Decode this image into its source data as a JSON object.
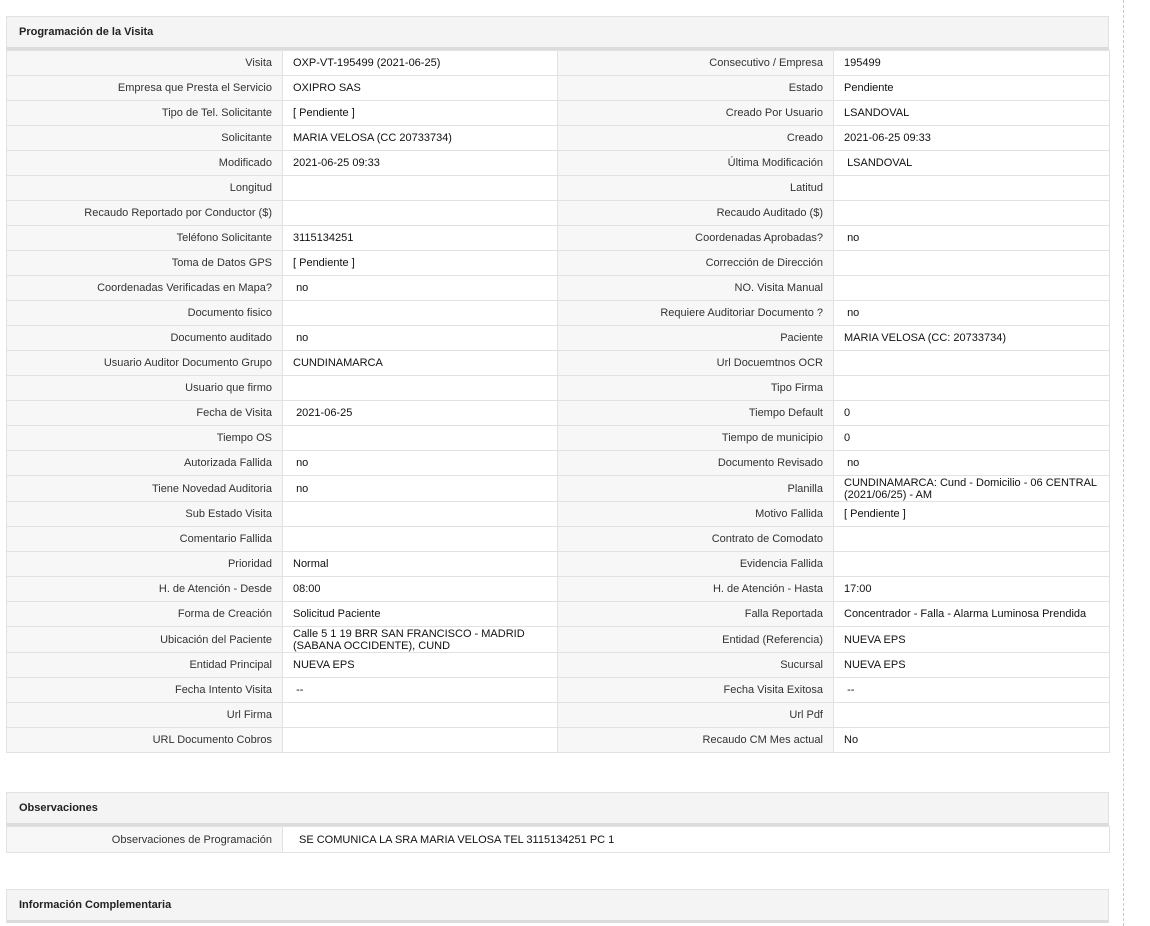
{
  "sections": {
    "programacion": "Programación de la Visita",
    "observaciones": "Observaciones",
    "informacion": "Información Complementaria"
  },
  "rows": [
    {
      "l1": "Visita",
      "v1": "OXP-VT-195499 (2021-06-25)",
      "l2": "Consecutivo / Empresa",
      "v2": "195499"
    },
    {
      "l1": "Empresa que Presta el Servicio",
      "v1": "OXIPRO SAS",
      "l2": "Estado",
      "v2": "Pendiente"
    },
    {
      "l1": "Tipo de Tel. Solicitante",
      "v1": "[ Pendiente ]",
      "l2": "Creado Por Usuario",
      "v2": "LSANDOVAL"
    },
    {
      "l1": "Solicitante",
      "v1": "MARIA VELOSA (CC 20733734)",
      "l2": "Creado",
      "v2": "2021-06-25 09:33"
    },
    {
      "l1": "Modificado",
      "v1": "2021-06-25 09:33",
      "l2": "Última Modificación",
      "v2": " LSANDOVAL"
    },
    {
      "l1": "Longitud",
      "v1": "",
      "l2": "Latitud",
      "v2": ""
    },
    {
      "l1": "Recaudo Reportado por Conductor ($)",
      "v1": "",
      "l2": "Recaudo Auditado ($)",
      "v2": ""
    },
    {
      "l1": "Teléfono Solicitante",
      "v1": "3115134251",
      "l2": "Coordenadas Aprobadas?",
      "v2": " no"
    },
    {
      "l1": "Toma de Datos GPS",
      "v1": "[ Pendiente ]",
      "l2": "Corrección de Dirección",
      "v2": ""
    },
    {
      "l1": "Coordenadas Verificadas en Mapa?",
      "v1": " no",
      "l2": "NO. Visita Manual",
      "v2": ""
    },
    {
      "l1": "Documento fisico",
      "v1": "",
      "l2": "Requiere Auditoriar Documento ?",
      "v2": " no"
    },
    {
      "l1": "Documento auditado",
      "v1": " no",
      "l2": "Paciente",
      "v2": "MARIA VELOSA (CC: 20733734)"
    },
    {
      "l1": "Usuario Auditor Documento Grupo",
      "v1": "CUNDINAMARCA",
      "l2": "Url Docuemtnos OCR",
      "v2": ""
    },
    {
      "l1": "Usuario que firmo",
      "v1": "",
      "l2": "Tipo Firma",
      "v2": ""
    },
    {
      "l1": "Fecha de Visita",
      "v1": " 2021-06-25",
      "l2": "Tiempo Default",
      "v2": "0"
    },
    {
      "l1": "Tiempo OS",
      "v1": "",
      "l2": "Tiempo de municipio",
      "v2": "0"
    },
    {
      "l1": "Autorizada Fallida",
      "v1": " no",
      "l2": "Documento Revisado",
      "v2": " no"
    },
    {
      "l1": "Tiene Novedad Auditoria",
      "v1": " no",
      "l2": "Planilla",
      "v2": "CUNDINAMARCA: Cund - Domicilio - 06 CENTRAL (2021/06/25) - AM"
    },
    {
      "l1": "Sub Estado Visita",
      "v1": "",
      "l2": "Motivo Fallida",
      "v2": "[ Pendiente ]"
    },
    {
      "l1": "Comentario Fallida",
      "v1": "",
      "l2": "Contrato de Comodato",
      "v2": ""
    },
    {
      "l1": "Prioridad",
      "v1": "Normal",
      "l2": "Evidencia Fallida",
      "v2": ""
    },
    {
      "l1": "H. de Atención - Desde",
      "v1": "08:00",
      "l2": "H. de Atención - Hasta",
      "v2": "17:00"
    },
    {
      "l1": "Forma de Creación",
      "v1": "Solicitud Paciente",
      "l2": "Falla Reportada",
      "v2": "Concentrador - Falla - Alarma Luminosa Prendida"
    },
    {
      "l1": "Ubicación del Paciente",
      "v1": "Calle 5 1 19 BRR SAN FRANCISCO - MADRID (SABANA OCCIDENTE), CUND",
      "l2": "Entidad (Referencia)",
      "v2": "NUEVA EPS"
    },
    {
      "l1": "Entidad Principal",
      "v1": "NUEVA EPS",
      "l2": "Sucursal",
      "v2": "NUEVA EPS"
    },
    {
      "l1": "Fecha Intento Visita",
      "v1": " --",
      "l2": "Fecha Visita Exitosa",
      "v2": " --"
    },
    {
      "l1": "Url Firma",
      "v1": "",
      "l2": "Url Pdf",
      "v2": ""
    },
    {
      "l1": "URL Documento Cobros",
      "v1": "",
      "l2": "Recaudo CM Mes actual",
      "v2": "No"
    }
  ],
  "observaciones": {
    "label": "Observaciones de Programación",
    "value": "SE COMUNICA LA SRA MARIA VELOSA TEL 3115134251 PC 1"
  }
}
